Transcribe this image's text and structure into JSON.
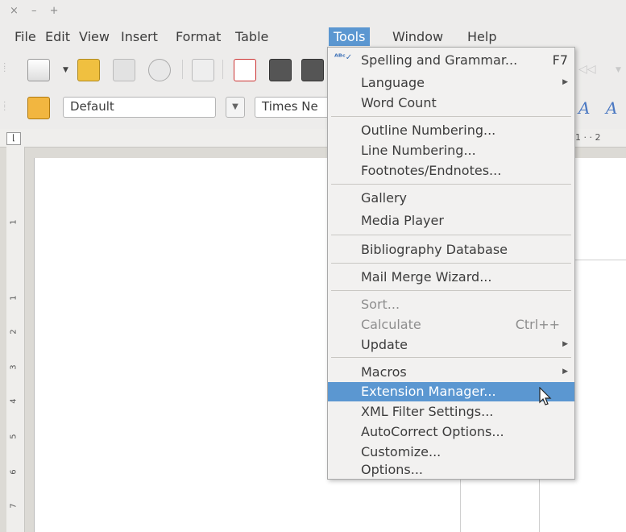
{
  "window_controls": "× – +",
  "menubar": {
    "items": [
      "File",
      "Edit",
      "View",
      "Insert",
      "Format",
      "Table",
      "Tools",
      "Window",
      "Help"
    ],
    "active": "Tools"
  },
  "format_toolbar": {
    "paragraph_style": "Default",
    "font_name": "Times Ne"
  },
  "ruler": {
    "h_marks": "1 · · 2",
    "v_numbers": [
      "1",
      "1",
      "2",
      "3",
      "4",
      "5",
      "6",
      "7"
    ]
  },
  "tools_menu": {
    "spelling": {
      "label": "Spelling and Grammar...",
      "shortcut": "F7"
    },
    "language": {
      "label": "Language"
    },
    "word_count": {
      "label": "Word Count"
    },
    "outline_numbering": {
      "label": "Outline Numbering..."
    },
    "line_numbering": {
      "label": "Line Numbering..."
    },
    "footnotes": {
      "label": "Footnotes/Endnotes..."
    },
    "gallery": {
      "label": "Gallery"
    },
    "media_player": {
      "label": "Media Player"
    },
    "bibliography": {
      "label": "Bibliography Database"
    },
    "mail_merge": {
      "label": "Mail Merge Wizard..."
    },
    "sort": {
      "label": "Sort..."
    },
    "calculate": {
      "label": "Calculate",
      "shortcut": "Ctrl++"
    },
    "update": {
      "label": "Update"
    },
    "macros": {
      "label": "Macros"
    },
    "extension_manager": {
      "label": "Extension Manager..."
    },
    "xml_filter": {
      "label": "XML Filter Settings..."
    },
    "autocorrect": {
      "label": "AutoCorrect Options..."
    },
    "customize": {
      "label": "Customize..."
    },
    "options": {
      "label": "Options..."
    }
  },
  "colors": {
    "highlight": "#5b97d1",
    "menu_bg": "#f2f1f0",
    "window_bg": "#edeceb"
  }
}
